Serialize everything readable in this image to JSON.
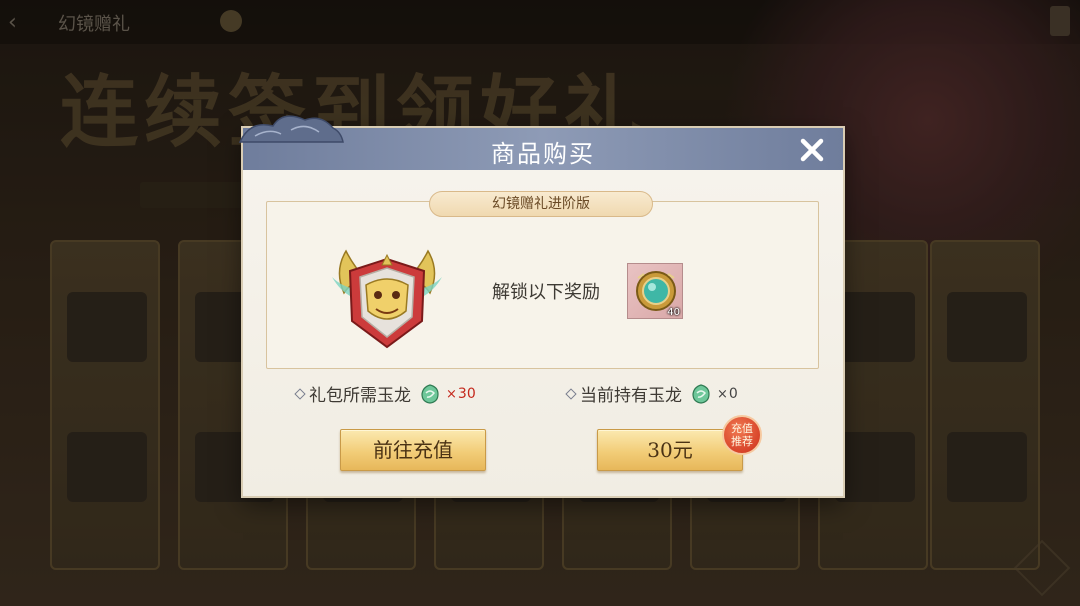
{
  "background": {
    "back_label": "‹",
    "title": "幻镜赠礼",
    "banner": "连续签到领好礼"
  },
  "dialog": {
    "title": "商品购买",
    "close_icon": "close-x-icon",
    "pack_name": "幻镜赠礼进阶版",
    "unlock_text": "解锁以下奖励",
    "reward": {
      "icon": "jade-mirror-icon",
      "count": "40"
    },
    "required": {
      "label": "礼包所需玉龙",
      "icon": "jade-dragon-icon",
      "x": "×",
      "qty": "30"
    },
    "owned": {
      "label": "当前持有玉龙",
      "icon": "jade-dragon-icon",
      "x": "×",
      "qty": "0"
    },
    "recharge_button": "前往充值",
    "price_button": "30元",
    "badge": "充值推荐",
    "badge_line1": "充值",
    "badge_line2": "推荐"
  },
  "colors": {
    "header": "#8e9bb6",
    "button": "#f2cd78",
    "required_qty": "#c4281c",
    "badge": "#d8442a"
  }
}
